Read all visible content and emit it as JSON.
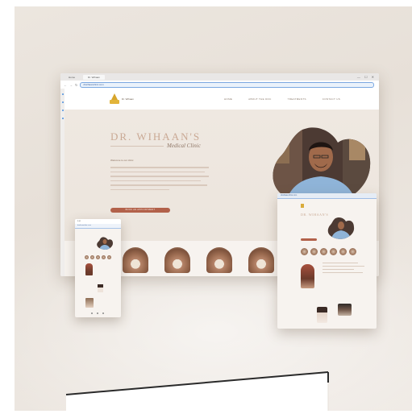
{
  "desktop": {
    "tabs": [
      "Home",
      "Dr. Wihaan"
    ],
    "window_controls": "— ☐ ✕",
    "url": "drwihaanclinic.com",
    "logo_text": "Dr. Wihaan",
    "menu": [
      "HOME",
      "ABOUT THE DOC",
      "TREATMENTS",
      "CONTACT US"
    ],
    "hero": {
      "title": "DR. WIHAAN'S",
      "subtitle": "Medical Clinic",
      "tagline": "Welcome to our clinic",
      "cta": "BOOK AN APPOINTMENT"
    }
  },
  "tablet": {
    "url": "drwihaanclinic.com",
    "title": "DR. WIHAAN'S"
  },
  "phone": {
    "status": "9:41",
    "url": "drwihaanclinic.com"
  },
  "colors": {
    "background": "#e9e2da",
    "accent": "#b2614a",
    "title": "#c9a994",
    "logo": "#d7a52b"
  }
}
